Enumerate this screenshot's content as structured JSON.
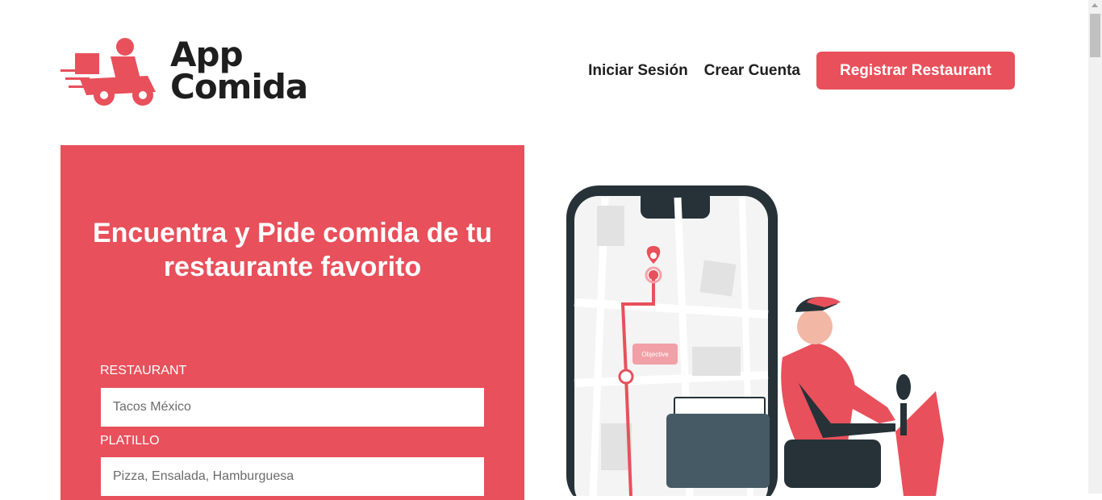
{
  "brand": {
    "line1": "App",
    "line2": "Comida"
  },
  "nav": {
    "login": "Iniciar Sesión",
    "signup": "Crear Cuenta",
    "register_restaurant": "Registrar Restaurant"
  },
  "hero": {
    "title": "Encuentra y Pide comida de tu restaurante favorito",
    "restaurant_label": "RESTAURANT",
    "restaurant_placeholder": "Tacos México",
    "dish_label": "PLATILLO",
    "dish_placeholder": "Pizza, Ensalada, Hamburguesa"
  },
  "illustration": {
    "bubble_text": "Objective"
  },
  "colors": {
    "accent": "#e8505b",
    "dark": "#263238"
  }
}
